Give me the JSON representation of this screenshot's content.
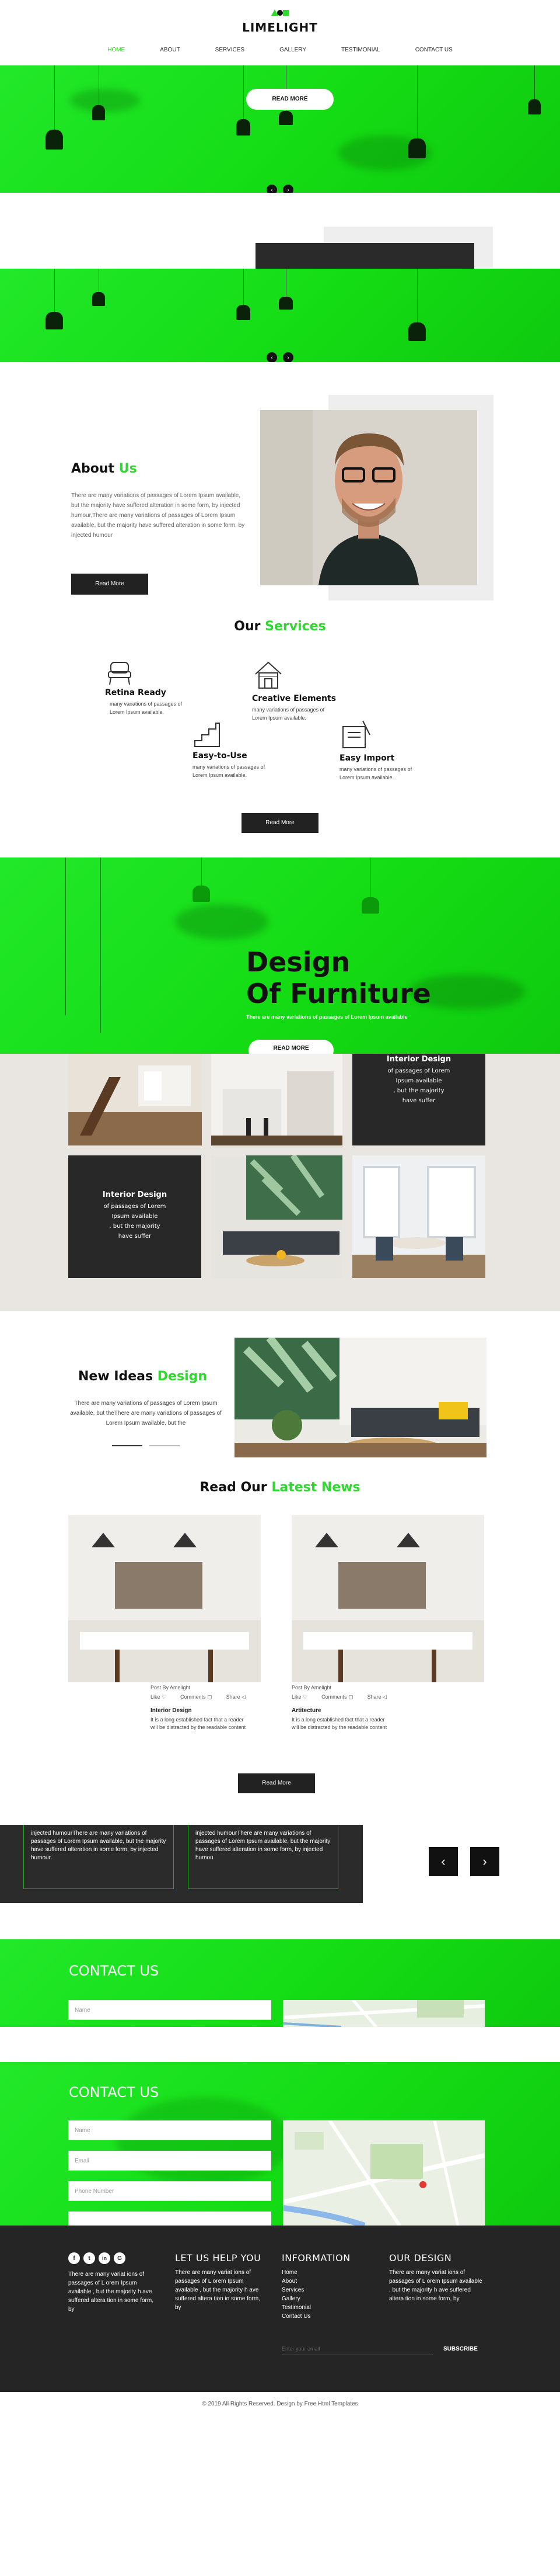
{
  "brand": {
    "name": "LIMELIGHT"
  },
  "nav": {
    "items": [
      "HOME",
      "ABOUT",
      "SERVICES",
      "GALLERY",
      "TESTIMONIAL",
      "CONTACT US"
    ]
  },
  "hero": {
    "read_more": "READ MORE"
  },
  "about": {
    "title_a": "About",
    "title_b": "Us",
    "text": "There are many variations of passages of Lorem Ipsum available, but the majority have suffered alteration in some form, by injected humour,There are many variations of passages of Lorem Ipsum available, but the majority have suffered alteration in some form, by injected humour",
    "button": "Read More"
  },
  "services": {
    "title_a": "Our",
    "title_b": "Services",
    "items": [
      {
        "title": "Retina Ready",
        "text": "many variations of passages of Lorem Ipsum available."
      },
      {
        "title": "Creative Elements",
        "text": "many variations of passages of Lorem Ipsum available."
      },
      {
        "title": "Easy-to-Use",
        "text": "many variations of passages of Lorem Ipsum available."
      },
      {
        "title": "Easy Import",
        "text": "many variations of passages of Lorem Ipsum available."
      }
    ],
    "button": "Read More"
  },
  "design": {
    "title_line1": "Design",
    "title_line2": "Of Furniture",
    "subtitle": "There are many variations of passages of Lorem Ipsum available",
    "read_more": "READ MORE"
  },
  "gallery": {
    "tile_top": {
      "title": "Interior Design",
      "lines": [
        "of passages of Lorem",
        "Ipsum available",
        ", but the majority",
        "have suffer"
      ]
    },
    "tile_bottom": {
      "title": "Interior Design",
      "lines": [
        "of passages of Lorem",
        "Ipsum available",
        ", but the majority",
        "have suffer"
      ]
    }
  },
  "new_ideas": {
    "title_a": "New Ideas",
    "title_b": "Design",
    "text": "There are many variations of passages of Lorem Ipsum available, but theThere are many variations of passages of Lorem Ipsum available, but the"
  },
  "news": {
    "title_a": "Read Our",
    "title_b": "Latest News",
    "posts": [
      {
        "post_by": "Post By Amelight",
        "like": "Like",
        "comments": "Comments",
        "share": "Share",
        "title": "Interior Design",
        "text": "It is a long established fact that a reader will be distracted by the readable content"
      },
      {
        "post_by": "Post By Amelight",
        "like": "Like",
        "comments": "Comments",
        "share": "Share",
        "title": "Artitecture",
        "text": "It is a long established fact that a reader will be distracted by the readable content"
      }
    ],
    "button": "Read More"
  },
  "testimonials": {
    "items": [
      "injected humourThere are many variations of passages of Lorem Ipsum available, but the majority have suffered alteration in some form, by injected humour.",
      "injected humourThere are many variations of passages of Lorem Ipsum available, but the majority have suffered alteration in some form, by injected humou"
    ],
    "prev": "‹",
    "next": "›"
  },
  "contact1": {
    "title": "CONTACT US",
    "name_placeholder": "Name"
  },
  "contact2": {
    "title": "CONTACT US",
    "name_placeholder": "Name",
    "email_placeholder": "Email",
    "phone_placeholder": "Phone Number"
  },
  "footer": {
    "col1_text": "There are many variat ions of passages of L orem Ipsum available , but the majority h ave suffered altera tion in some form, by",
    "col2_title": "LET US HELP YOU",
    "col2_text": "There are many variat ions of passages of L orem Ipsum available , but the majority h ave suffered altera tion in some form, by",
    "col3_title": "INFORMATION",
    "col3_links": [
      "Home",
      "About",
      "Services",
      "Gallery",
      "Testimonial",
      "Contact Us"
    ],
    "col4_title": "OUR DESIGN",
    "col4_text": "There are many variat ions of passages of L orem Ipsum available , but the majority h ave suffered altera tion in some form, by",
    "email_placeholder": "Enter your email",
    "subscribe": "SUBSCRIBE",
    "social": [
      "f",
      "t",
      "in",
      "G"
    ]
  },
  "copyright": "© 2019 All Rights Reserved. Design by Free Html Templates",
  "colors": {
    "accent": "#2fd82f",
    "dark": "#222222"
  }
}
